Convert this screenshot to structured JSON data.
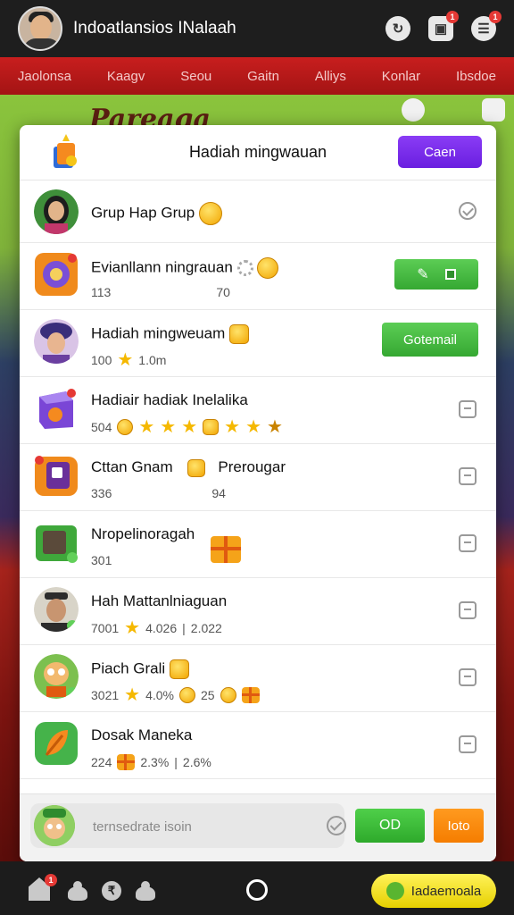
{
  "header": {
    "title": "Indoatlansios INalaah",
    "icons": [
      "refresh-icon",
      "clipboard-icon",
      "menu-icon"
    ],
    "clipboard_badge": "1",
    "menu_badge": "1"
  },
  "categories": [
    "Jaolonsa",
    "Kaagv",
    "Seou",
    "Gaitn",
    "Alliys",
    "Konlar",
    "Ibsdoe"
  ],
  "background": {
    "banner_text": "Pareaga"
  },
  "modal": {
    "title": "Hadiah mingwauan",
    "action_label": "Caen",
    "rows": [
      {
        "title": "Grup Hap Grup",
        "sub": [],
        "icon": "girl-avatar-icon",
        "check": "circle"
      },
      {
        "title": "Evianllann ningrauan",
        "sub": [
          "113",
          "70"
        ],
        "icon": "game-controller-icon",
        "button": "edit"
      },
      {
        "title": "Hadiah mingweuam",
        "sub": [
          "100",
          "1.0m"
        ],
        "icon": "woman-avatar-icon",
        "button_label": "Gotemail"
      },
      {
        "title": "Hadiair hadiak Inelalika",
        "sub": [
          "504"
        ],
        "icon": "purple-box-icon",
        "check": "square"
      },
      {
        "title": "Cttan Gnam",
        "title2": "Prerougar",
        "sub": [
          "336",
          "94"
        ],
        "icon": "orange-tablet-icon",
        "check": "square"
      },
      {
        "title": "Nropelinoragah",
        "sub": [
          "301"
        ],
        "icon": "green-cabinet-icon",
        "check": "square"
      },
      {
        "title": "Hah Mattanlniaguan",
        "sub": [
          "7001",
          "4.026",
          "2.022"
        ],
        "icon": "man-avatar-icon",
        "check": "square"
      },
      {
        "title": "Piach Grali",
        "sub": [
          "3021",
          "4.0%",
          "25"
        ],
        "icon": "cartoon-character-icon",
        "check": "square"
      },
      {
        "title": "Dosak Maneka",
        "sub": [
          "224",
          "2.3%",
          "2.6%"
        ],
        "icon": "orange-leaf-icon",
        "check": "square"
      }
    ],
    "footer": {
      "placeholder": "ternsedrate isoin",
      "send_label": "OD",
      "orange_label": "Ioto"
    }
  },
  "bottom_nav": {
    "home_badge": "1",
    "yellow_button_label": "Iadaemoala"
  },
  "colors": {
    "accent_purple": "#7b2ff7",
    "green": "#3fb83b",
    "orange": "#f7870c",
    "yellow": "#f3e21b",
    "nav_red": "#b51a1a"
  }
}
